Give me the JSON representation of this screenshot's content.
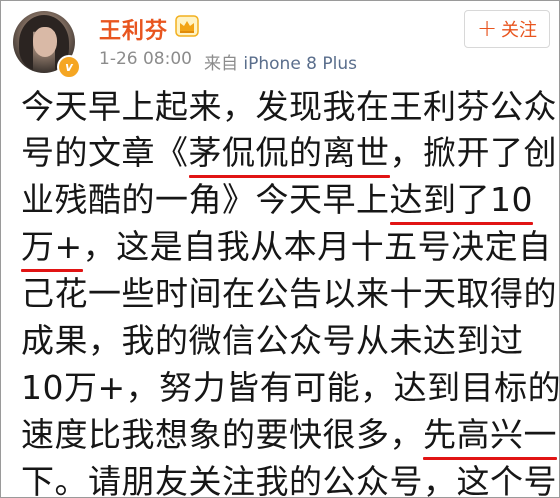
{
  "post": {
    "username": "王利芬",
    "timestamp": "1-26 08:00",
    "via": "来自",
    "client": "iPhone 8 Plus",
    "follow_plus": "+",
    "follow_label": "关注",
    "verified_mark": "v",
    "lines": [
      {
        "parts": [
          {
            "t": "今天早上起来，发现我在王利芬公众"
          }
        ]
      },
      {
        "parts": [
          {
            "t": "号的文章《"
          },
          {
            "t": "茅侃侃的离世",
            "u": true
          },
          {
            "t": "，掀开了创"
          }
        ]
      },
      {
        "parts": [
          {
            "t": "业残酷的一角》今天早上"
          },
          {
            "t": "达到了10",
            "u": true
          }
        ]
      },
      {
        "parts": [
          {
            "t": "万+",
            "u": true
          },
          {
            "t": "，这是自我从本月十五号决定自"
          }
        ]
      },
      {
        "parts": [
          {
            "t": "己花一些时间在公告以来十天取得的"
          }
        ]
      },
      {
        "parts": [
          {
            "t": "成果，我的微信公众号从未达到过"
          }
        ]
      },
      {
        "parts": [
          {
            "t": "10万+，努力皆有可能，达到目标的"
          }
        ]
      },
      {
        "parts": [
          {
            "t": "速度比我想象的要快很多，"
          },
          {
            "t": "先高兴一",
            "u": true
          }
        ]
      },
      {
        "parts": [
          {
            "t": "下。请朋友关注我的公众号",
            "u": true
          },
          {
            "t": "，这个号"
          }
        ]
      }
    ]
  },
  "colors": {
    "username": "#e8551f",
    "underline": "#e11414",
    "text": "#161616",
    "meta": "#8c8c8c"
  },
  "icons": [
    "crown-icon",
    "verified-badge-icon",
    "plus-icon"
  ]
}
